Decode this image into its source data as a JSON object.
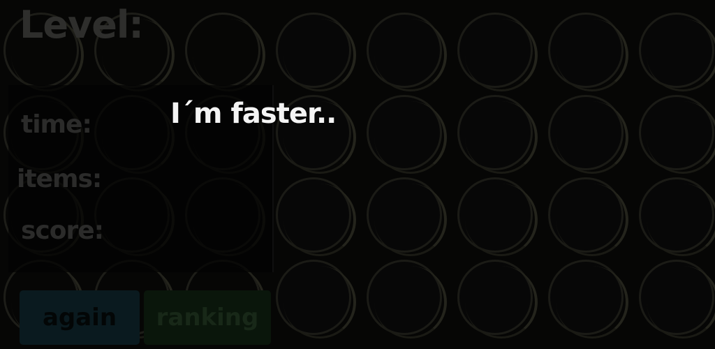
{
  "hud": {
    "level_label": "Level:",
    "time_label": "time:",
    "items_label": "items:",
    "score_label": "score:"
  },
  "overlay": {
    "message": "I´m faster.."
  },
  "buttons": {
    "again_label": "again",
    "ranking_label": "ranking"
  },
  "board": {
    "rows": 4,
    "columns": 8
  },
  "colors": {
    "background": "#060605",
    "message_text": "#f4f4f4",
    "again_button": "#0a1a1f",
    "ranking_button": "#0a160b"
  }
}
